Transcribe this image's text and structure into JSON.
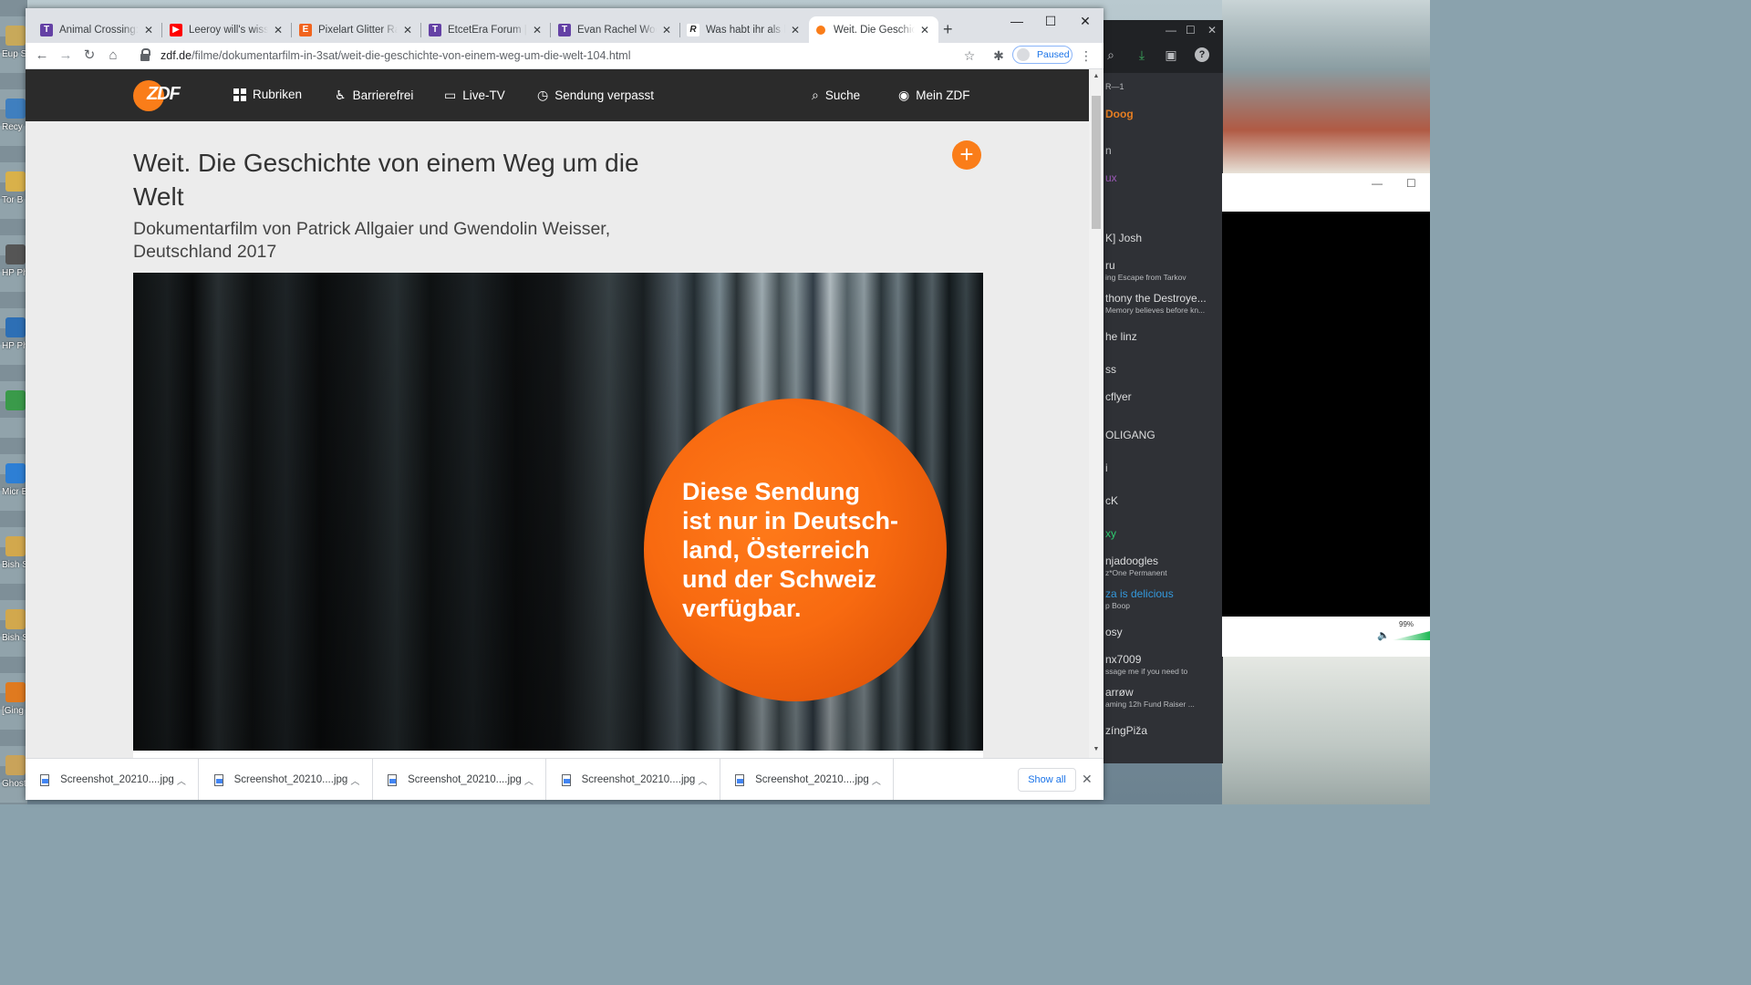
{
  "colors": {
    "zdf_orange": "#fa7d19",
    "zdf_nav": "#2b2b2b",
    "chrome_blue": "#1a73e8"
  },
  "browser": {
    "tabs": [
      {
        "title": "Animal Crossing: Ne",
        "favicon": "twitch-icon",
        "fav_color": "#6441a5",
        "glyph": "T"
      },
      {
        "title": "Leeroy will's wissen!",
        "favicon": "youtube-icon",
        "fav_color": "#ff0000",
        "glyph": "▶"
      },
      {
        "title": "Pixelart Glitter Rainb",
        "favicon": "etsy-icon",
        "fav_color": "#f1641e",
        "glyph": "E"
      },
      {
        "title": "EtcetEra Forum | Res",
        "favicon": "twitch-icon",
        "fav_color": "#6441a5",
        "glyph": "T"
      },
      {
        "title": "Evan Rachel Wood o",
        "favicon": "twitch-icon",
        "fav_color": "#6441a5",
        "glyph": "T"
      },
      {
        "title": "Was habt ihr als letz",
        "favicon": "resetera-icon",
        "fav_color": "#ffffff",
        "glyph": "R"
      },
      {
        "title": "Weit. Die Geschichte",
        "favicon": "zdf-icon",
        "fav_color": "#fa7d19",
        "glyph": ""
      }
    ],
    "url_domain": "zdf.de",
    "url_path": "/filme/dokumentarfilm-in-3sat/weit-die-geschichte-von-einem-weg-um-die-welt-104.html",
    "profile_status": "Paused"
  },
  "zdf": {
    "logo": "ZDF",
    "nav": {
      "rubriken": "Rubriken",
      "barrierefrei": "Barrierefrei",
      "livetv": "Live-TV",
      "verpasst": "Sendung verpasst",
      "suche": "Suche",
      "meinzdf": "Mein ZDF"
    },
    "title": "Weit. Die Geschichte von einem Weg um die Welt",
    "subtitle": "Dokumentarfilm von Patrick Allgaier und Gwendolin Weisser, Deutschland 2017",
    "geoblock_text": "Diese Sendung\nist nur in Deutsch-\nland, Österreich\nund der Schweiz\nverfügbar."
  },
  "downloads": {
    "items": [
      "Screenshot_20210....jpg",
      "Screenshot_20210....jpg",
      "Screenshot_20210....jpg",
      "Screenshot_20210....jpg",
      "Screenshot_20210....jpg"
    ],
    "show_all": "Show all"
  },
  "background_app": {
    "items": [
      {
        "name": "R—1",
        "sub": "",
        "color": "#b9bbbe"
      },
      {
        "name": "Doog",
        "sub": "",
        "color": "#e67e22"
      },
      {
        "name": "n",
        "sub": "",
        "color": "#b9bbbe"
      },
      {
        "name": "ux",
        "sub": "",
        "color": "#9b59b6"
      },
      {
        "name": "K] Josh",
        "sub": "",
        "color": "#dcddde"
      },
      {
        "name": "ru",
        "sub": "ing Escape from Tarkov",
        "color": "#dcddde"
      },
      {
        "name": "thony the Destroye...",
        "sub": "Memory believes before kn...",
        "color": "#dcddde"
      },
      {
        "name": "he linz",
        "sub": "",
        "color": "#dcddde"
      },
      {
        "name": "ss",
        "sub": "",
        "color": "#dcddde"
      },
      {
        "name": "cflyer",
        "sub": "",
        "color": "#dcddde"
      },
      {
        "name": "OLIGANG",
        "sub": "",
        "color": "#dcddde"
      },
      {
        "name": "i",
        "sub": "",
        "color": "#dcddde"
      },
      {
        "name": "cK",
        "sub": "",
        "color": "#dcddde"
      },
      {
        "name": "xy",
        "sub": "",
        "color": "#2ecc71"
      },
      {
        "name": "njadoogles",
        "sub": "z*One Permanent",
        "color": "#dcddde"
      },
      {
        "name": "za is delicious",
        "sub": "p Boop",
        "color": "#3498db"
      },
      {
        "name": "osy",
        "sub": "",
        "color": "#dcddde"
      },
      {
        "name": "nx7009",
        "sub": "ssage me if you need to",
        "color": "#dcddde"
      },
      {
        "name": "arrøw",
        "sub": "aming 12h Fund Raiser ...",
        "color": "#dcddde"
      },
      {
        "name": "zíngPiža",
        "sub": "",
        "color": "#dcddde"
      }
    ],
    "volume": "99%"
  },
  "desktop": {
    "icons": [
      "Eup Seas",
      "Recy",
      "Tor B",
      "HP Phot",
      "HP Phot",
      "",
      "Micr Ed",
      "Bish Sens",
      "Bish Sens",
      "[Ging",
      "Ghost"
    ]
  }
}
